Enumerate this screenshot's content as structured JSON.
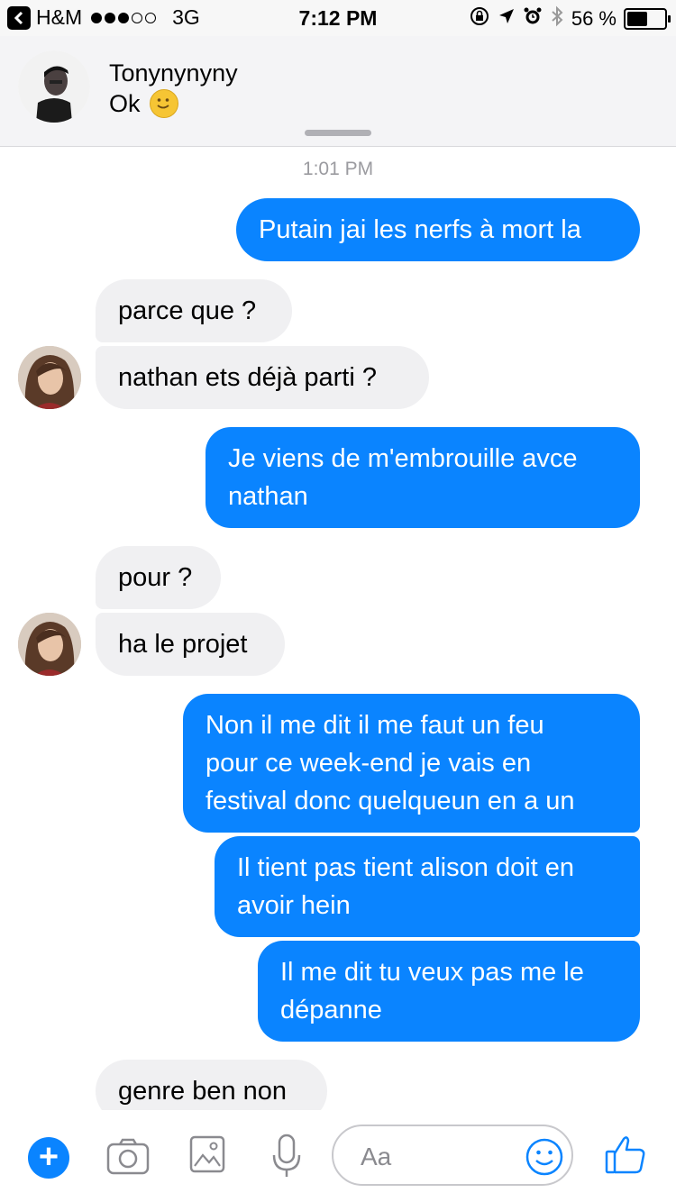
{
  "status_bar": {
    "carrier": "H&M",
    "network": "3G",
    "time": "7:12 PM",
    "battery_text": "56 %",
    "battery_level": 0.56,
    "signal_bars_filled": 3,
    "signal_bars_total": 5
  },
  "header": {
    "contact_name": "Tonynynyny",
    "contact_status": "Ok"
  },
  "conversation": {
    "timestamp": "1:01 PM",
    "messages": [
      {
        "from": "me",
        "text": "Putain jai les nerfs à mort la"
      },
      {
        "from": "them",
        "text": "parce que ?"
      },
      {
        "from": "them",
        "text": "nathan ets déjà parti ?"
      },
      {
        "from": "me",
        "lines": [
          "Je viens de m'embrouille avce",
          "nathan"
        ]
      },
      {
        "from": "them",
        "text": "pour ?"
      },
      {
        "from": "them",
        "text": "ha le projet"
      },
      {
        "from": "me",
        "lines": [
          "Non il me dit il me faut un feu",
          "pour ce week-end je vais en",
          "festival donc quelqueun en a un"
        ]
      },
      {
        "from": "me",
        "lines": [
          "Il tient pas tient alison doit en",
          "avoir hein"
        ]
      },
      {
        "from": "me",
        "lines": [
          "Il me dit tu veux pas me le",
          "dépanne"
        ]
      },
      {
        "from": "them",
        "text": "genre ben non"
      }
    ]
  },
  "composer": {
    "placeholder": "Aa"
  },
  "colors": {
    "accent": "#0a84ff",
    "incoming_bubble": "#f0f0f2"
  },
  "icons": [
    "back-icon",
    "alarm-lock-icon",
    "location-icon",
    "alarm-icon",
    "bluetooth-icon",
    "plus-icon",
    "camera-icon",
    "photo-icon",
    "microphone-icon",
    "emoji-icon",
    "thumbs-up-icon"
  ]
}
